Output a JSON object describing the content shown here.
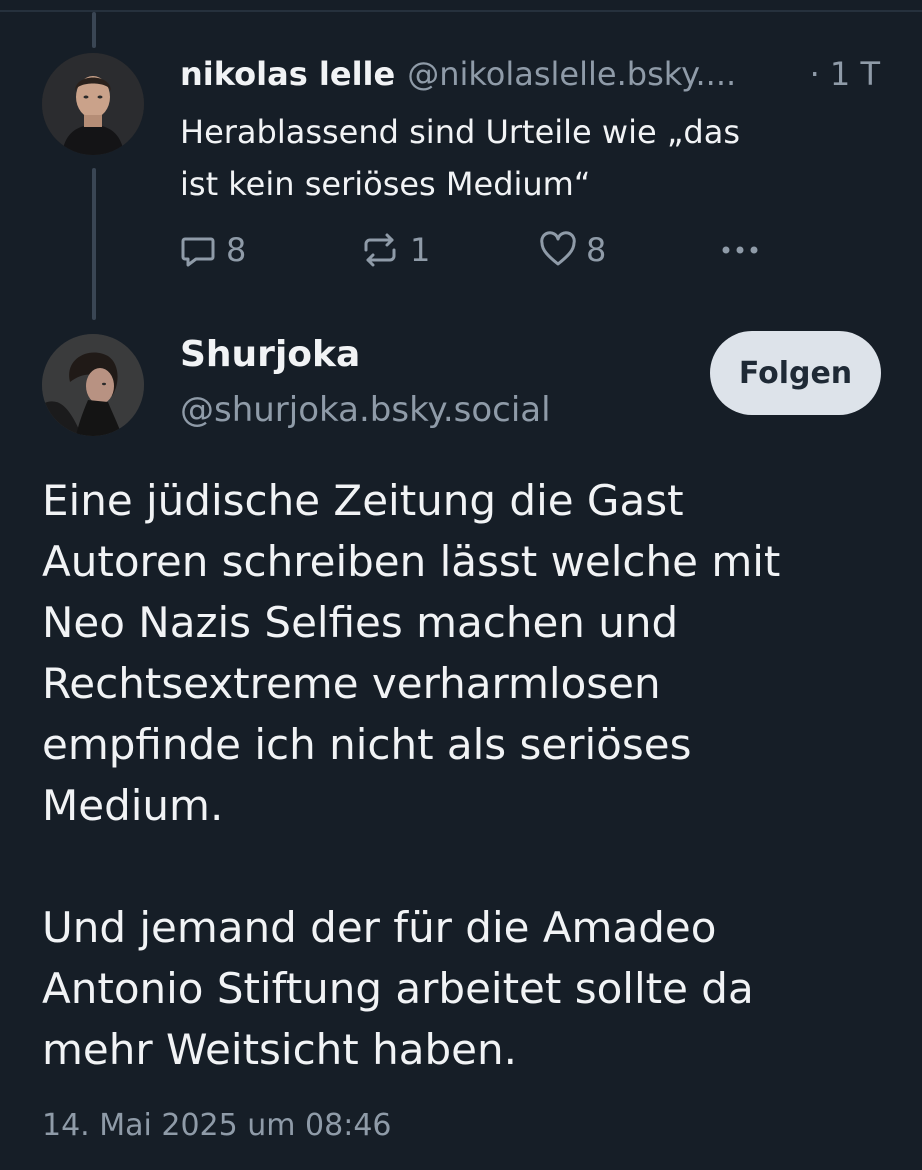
{
  "parent_post": {
    "name": "nikolas lelle",
    "handle": "@nikolaslelle.bsky....",
    "time": "· 1 T",
    "text_lines": [
      "Herablassend sind Urteile wie „das",
      "ist kein seriöses Medium“"
    ],
    "reply_count": "8",
    "repost_count": "1",
    "like_count": "8",
    "reply_icon": "reply-icon",
    "repost_icon": "repost-icon",
    "like_icon": "heart-icon",
    "more_icon": "more-icon"
  },
  "main_post": {
    "name": "Shurjoka",
    "handle": "@shurjoka.bsky.social",
    "follow_label": "Folgen",
    "text_paragraph_1_lines": [
      "Eine jüdische Zeitung die Gast",
      "Autoren schreiben lässt welche mit",
      "Neo Nazis Selfies machen und",
      "Rechtsextreme verharmlosen",
      "empfinde ich nicht als seriöses",
      "Medium."
    ],
    "text_paragraph_2_lines": [
      "Und jemand der für die Amadeo",
      "Antonio Stiftung arbeitet sollte da",
      "mehr Weitsicht haben."
    ],
    "timestamp": "14. Mai 2025 um 08:46"
  },
  "colors": {
    "background": "#161e27",
    "text": "#f1f3f5",
    "muted": "#8f9ba8",
    "follow_button_bg": "#dde3ea"
  }
}
